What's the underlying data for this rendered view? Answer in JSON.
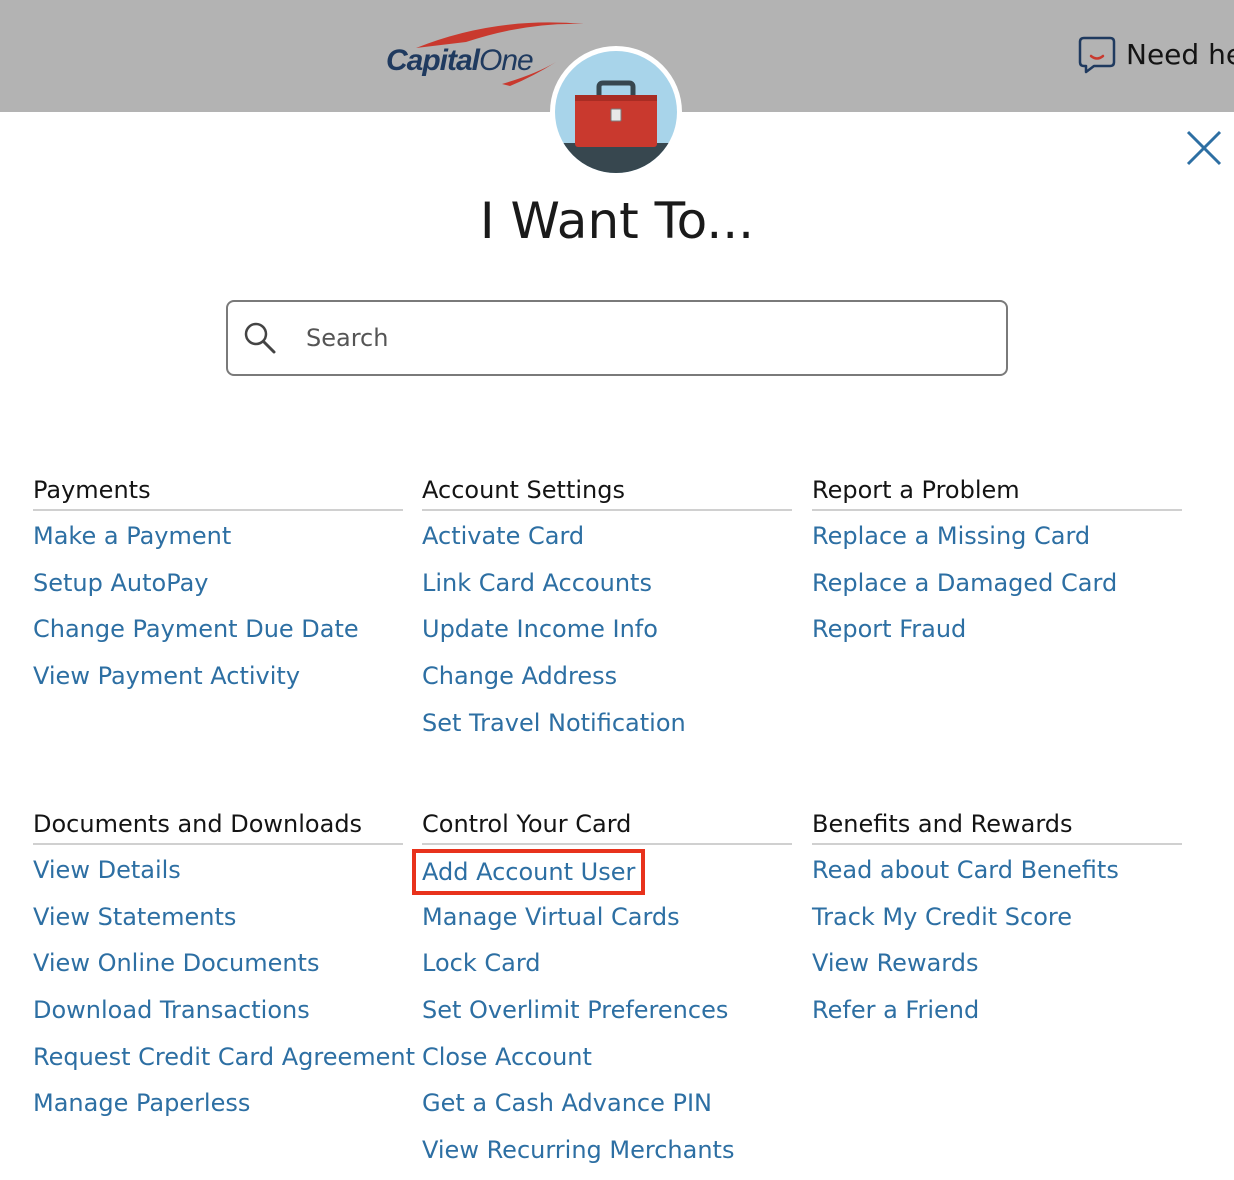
{
  "header": {
    "logo_bold": "Capital",
    "logo_light": "One",
    "help_text": "Need help?"
  },
  "modal": {
    "title": "I Want To...",
    "search": {
      "placeholder": "Search",
      "value": ""
    },
    "sections": {
      "payments": {
        "title": "Payments",
        "links": [
          "Make a Payment",
          "Setup AutoPay",
          "Change Payment Due Date",
          "View Payment Activity"
        ]
      },
      "account_settings": {
        "title": "Account Settings",
        "links": [
          "Activate Card",
          "Link Card Accounts",
          "Update Income Info",
          "Change Address",
          "Set Travel Notification"
        ]
      },
      "report_problem": {
        "title": "Report a Problem",
        "links": [
          "Replace a Missing Card",
          "Replace a Damaged Card",
          "Report Fraud"
        ]
      },
      "documents": {
        "title": "Documents and Downloads",
        "links": [
          "View Details",
          "View Statements",
          "View Online Documents",
          "Download Transactions",
          "Request Credit Card Agreement",
          "Manage Paperless"
        ]
      },
      "control_card": {
        "title": "Control Your Card",
        "links": [
          "Add Account User",
          "Manage Virtual Cards",
          "Lock Card",
          "Set Overlimit Preferences",
          "Close Account",
          "Get a Cash Advance PIN",
          "View Recurring Merchants"
        ]
      },
      "benefits": {
        "title": "Benefits and Rewards",
        "links": [
          "Read about Card Benefits",
          "Track My Credit Score",
          "View Rewards",
          "Refer a Friend"
        ]
      }
    },
    "highlighted_link": "Add Account User"
  },
  "colors": {
    "link": "#2d6fa3",
    "header_bg": "#b3b3b3",
    "highlight": "#e8321c",
    "toolbox": "#c9392e",
    "avatar_bg": "#a8d4ea"
  }
}
